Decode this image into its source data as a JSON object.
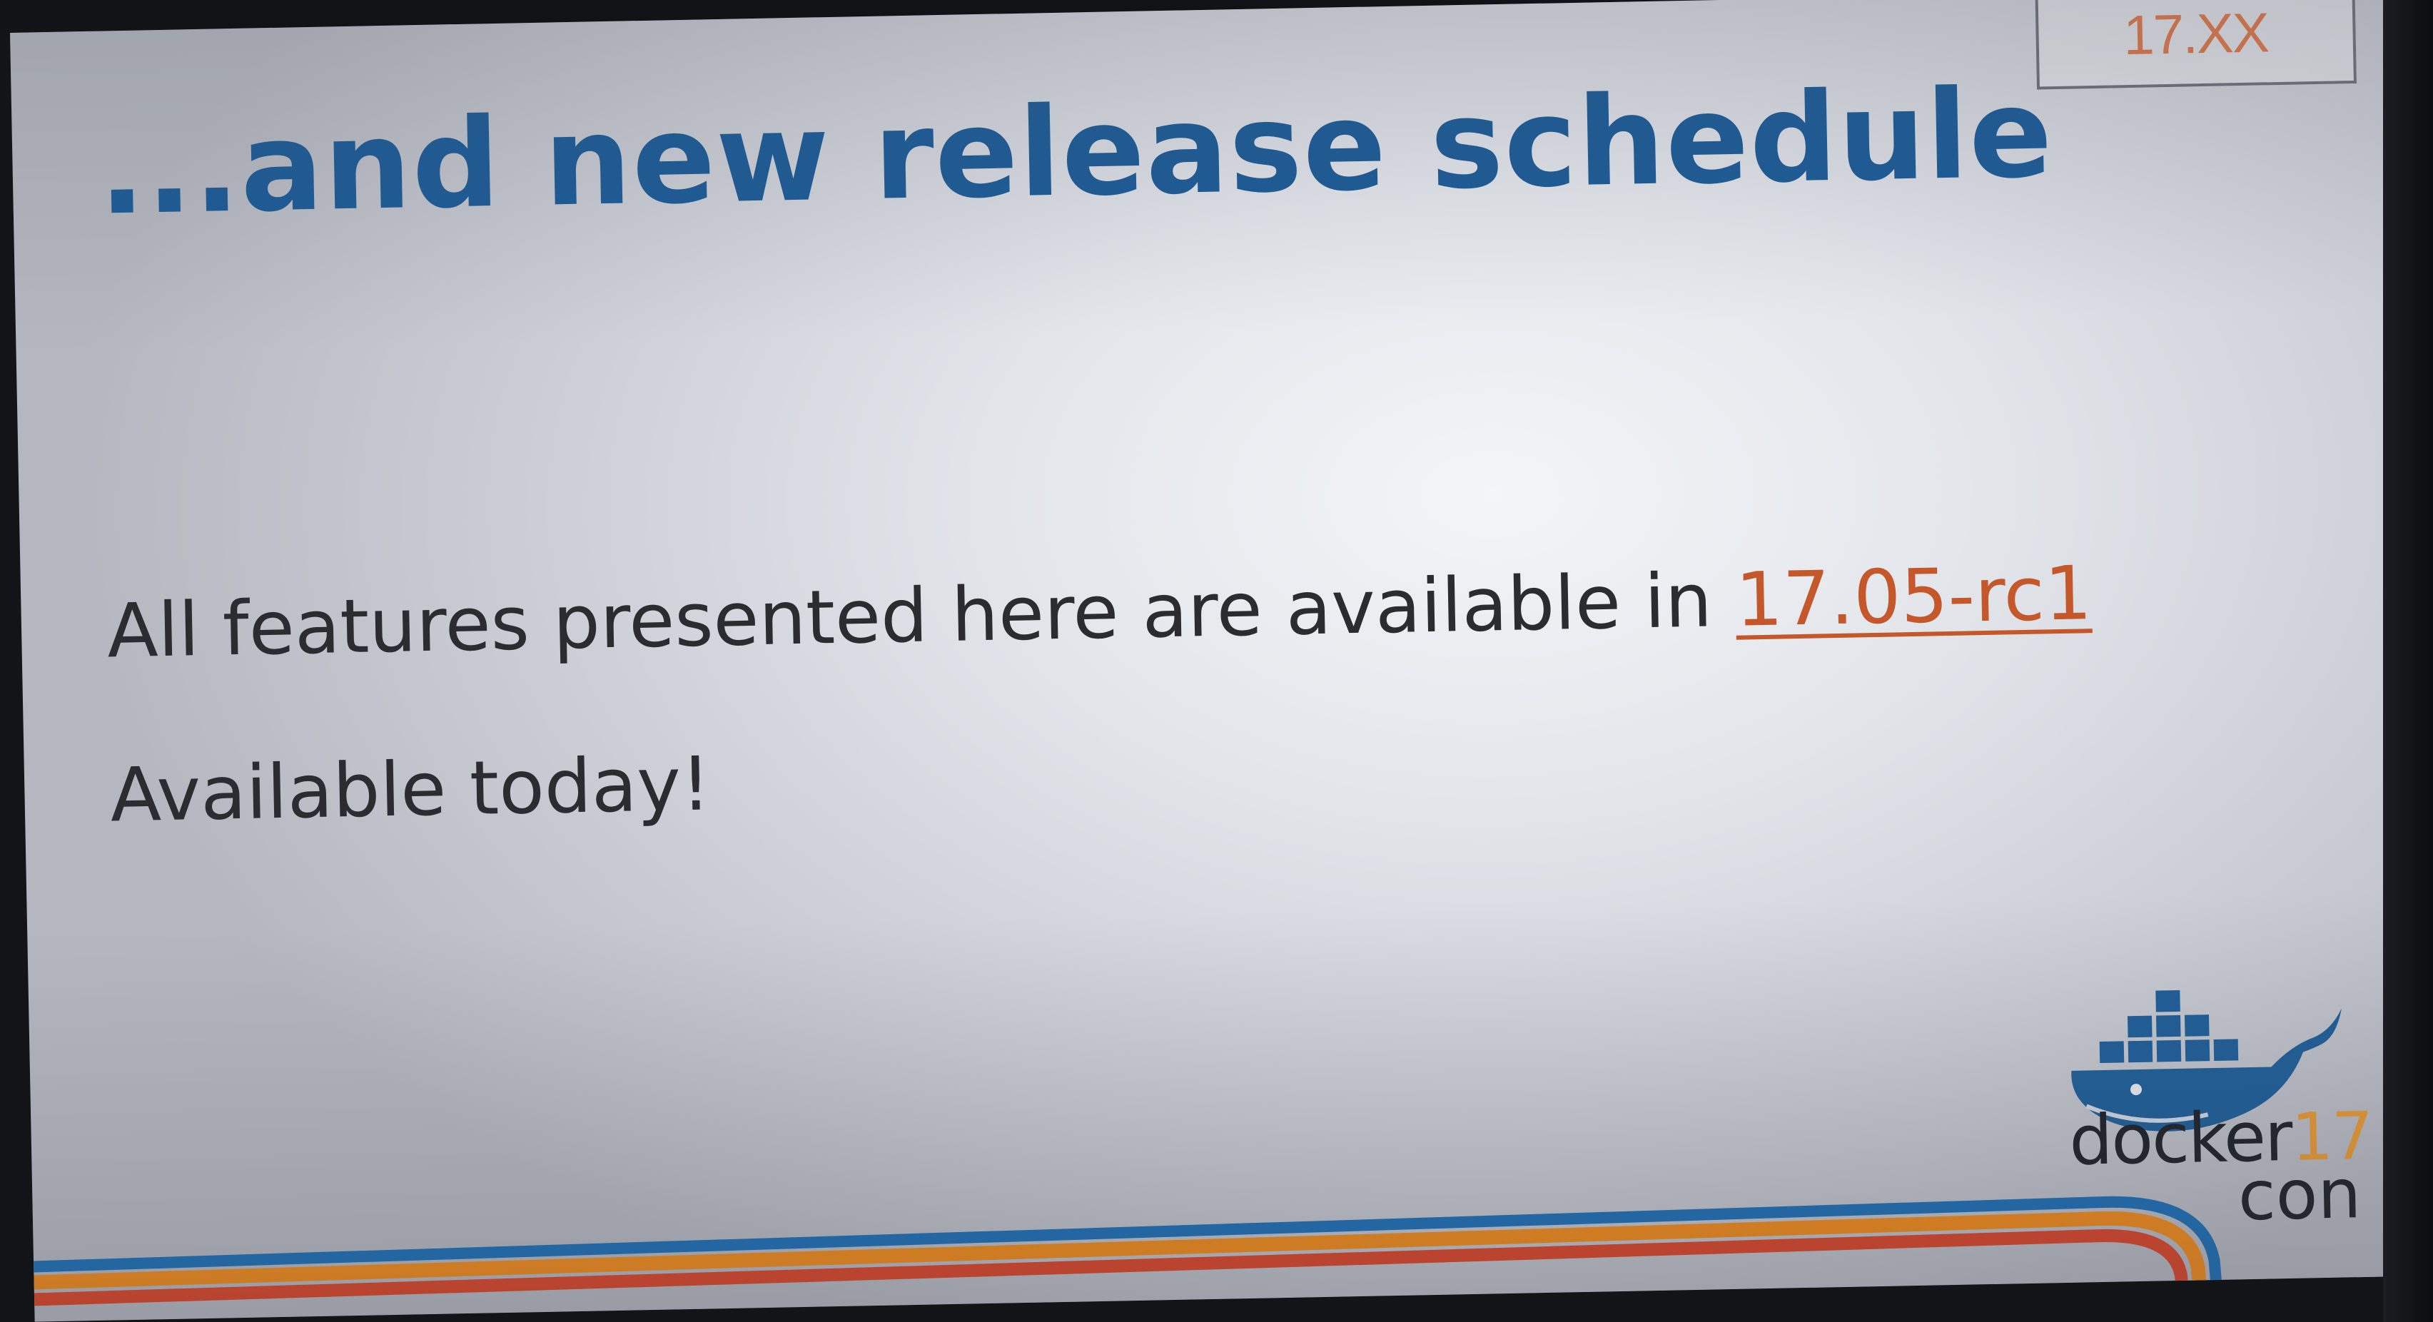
{
  "slide": {
    "version_tab": "17.XX",
    "title": "...and new release schedule",
    "line1_text": "All features presented here are available in ",
    "line1_link": "17.05-rc1",
    "line2_text": "Available today!"
  },
  "logo": {
    "word": "docker",
    "number": "17",
    "sub": "con"
  },
  "colors": {
    "title": "#1b5b96",
    "link": "#c4582b",
    "body_text": "#2a2c30",
    "stripe_blue": "#1f6fb5",
    "stripe_orange": "#f08a1c",
    "stripe_red": "#d9462a",
    "logo_blue": "#1f5f99"
  }
}
